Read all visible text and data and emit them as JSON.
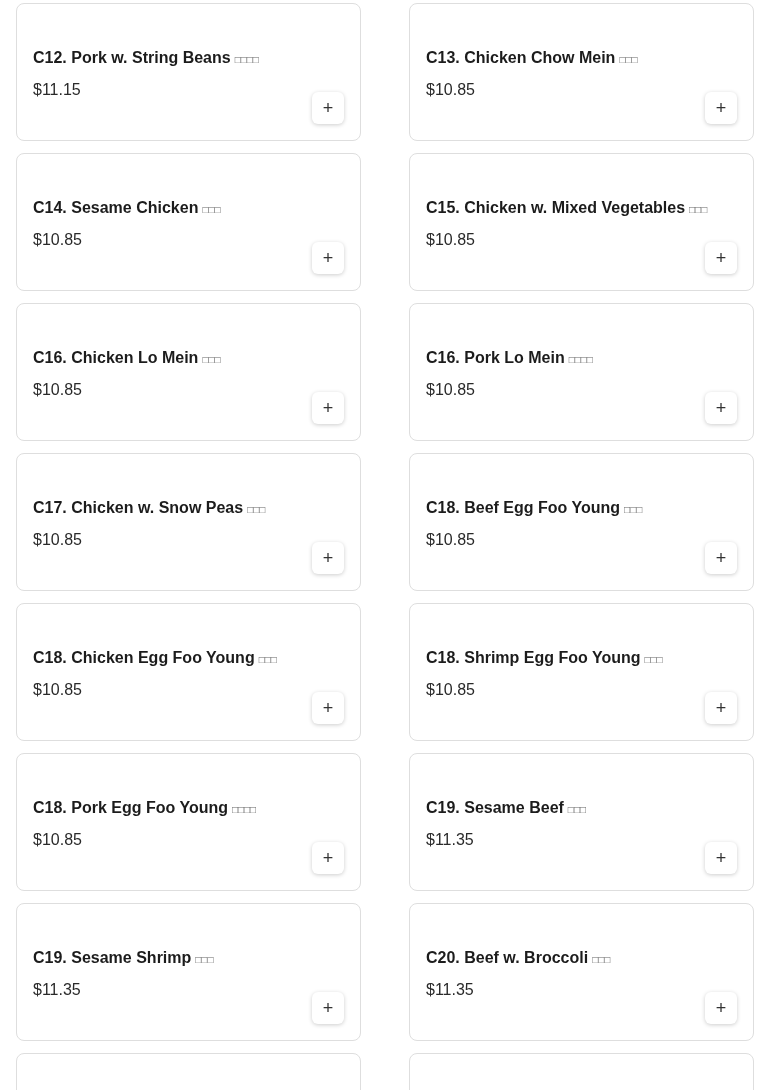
{
  "items": [
    {
      "name": "C12. Pork w. String Beans",
      "native": "□□□□",
      "price": "$11.15",
      "add": "+"
    },
    {
      "name": "C13. Chicken Chow Mein",
      "native": "□□□",
      "price": "$10.85",
      "add": "+"
    },
    {
      "name": "C14. Sesame Chicken",
      "native": "□□□",
      "price": "$10.85",
      "add": "+"
    },
    {
      "name": "C15. Chicken w. Mixed Vegetables",
      "native": "□□□",
      "price": "$10.85",
      "add": "+"
    },
    {
      "name": "C16. Chicken Lo Mein",
      "native": "□□□",
      "price": "$10.85",
      "add": "+"
    },
    {
      "name": "C16. Pork Lo Mein",
      "native": "□□□□",
      "price": "$10.85",
      "add": "+"
    },
    {
      "name": "C17. Chicken w. Snow Peas",
      "native": "□□□",
      "price": "$10.85",
      "add": "+"
    },
    {
      "name": "C18. Beef Egg Foo Young",
      "native": "□□□",
      "price": "$10.85",
      "add": "+"
    },
    {
      "name": "C18. Chicken Egg Foo Young",
      "native": "□□□",
      "price": "$10.85",
      "add": "+"
    },
    {
      "name": "C18. Shrimp Egg Foo Young",
      "native": "□□□",
      "price": "$10.85",
      "add": "+"
    },
    {
      "name": "C18. Pork Egg Foo Young",
      "native": "□□□□",
      "price": "$10.85",
      "add": "+"
    },
    {
      "name": "C19. Sesame Beef",
      "native": "□□□",
      "price": "$11.35",
      "add": "+"
    },
    {
      "name": "C19. Sesame Shrimp",
      "native": "□□□",
      "price": "$11.35",
      "add": "+"
    },
    {
      "name": "C20. Beef w. Broccoli",
      "native": "□□□",
      "price": "$11.35",
      "add": "+"
    }
  ]
}
